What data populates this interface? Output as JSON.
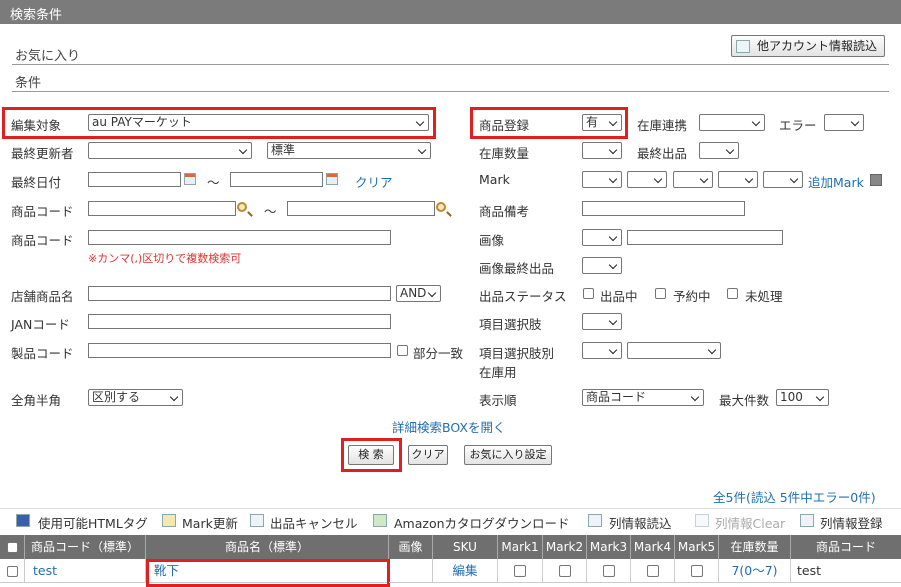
{
  "header": {
    "title": "検索条件"
  },
  "favorites": {
    "title": "お気に入り",
    "other_account_button": "他アカウント情報読込"
  },
  "conditions": {
    "title": "条件"
  },
  "left": {
    "edit_target_label": "編集対象",
    "edit_target_value": "au PAYマーケット",
    "last_updater_label": "最終更新者",
    "last_updater_mode": "標準",
    "last_date_label": "最終日付",
    "tilde": "～",
    "clear_link": "クリア",
    "product_code_label": "商品コード",
    "product_code2_label": "商品コード",
    "comma_note": "※カンマ(,)区切りで複数検索可",
    "shop_product_label": "店舗商品名",
    "shop_product_op": "AND",
    "jan_label": "JANコード",
    "maker_code_label": "製品コード",
    "partial_match_label": "部分一致",
    "width_label": "全角半角",
    "width_value": "区別する"
  },
  "right": {
    "registration_label": "商品登録",
    "registration_value": "有",
    "stock_link_label": "在庫連携",
    "error_label": "エラー",
    "stock_qty_label": "在庫数量",
    "last_listing_label": "最終出品",
    "mark_label": "Mark",
    "add_mark_link": "追加Mark",
    "remarks_label": "商品備考",
    "image_label": "画像",
    "image_last_label": "画像最終出品",
    "listing_status_label": "出品ステータス",
    "status_listing": "出品中",
    "status_reserved": "予約中",
    "status_unprocessed": "未処理",
    "variant_label": "項目選択肢",
    "variant_stock_label1": "項目選択肢別",
    "variant_stock_label2": "在庫用",
    "sort_label": "表示順",
    "sort_value": "商品コード",
    "max_label": "最大件数",
    "max_value": "100"
  },
  "advanced_link": "詳細検索BOXを開く",
  "buttons": {
    "search": "検 索",
    "clear": "クリア",
    "fav_settings": "お気に入り設定"
  },
  "summary": {
    "text": "全5件(読込 5件中エラー0件)"
  },
  "toolbar": {
    "html_tag": "使用可能HTMLタグ",
    "mark_update": "Mark更新",
    "cancel_listing": "出品キャンセル",
    "amazon_download": "Amazonカタログダウンロード",
    "column_load": "列情報読込",
    "column_clear": "列情報Clear",
    "column_register": "列情報登録"
  },
  "table": {
    "headers": [
      "商品コード（標準）",
      "商品名（標準）",
      "画像",
      "SKU",
      "Mark1",
      "Mark2",
      "Mark3",
      "Mark4",
      "Mark5",
      "在庫数量",
      "商品コード"
    ],
    "row": {
      "code": "test",
      "name": "靴下",
      "sku": "編集",
      "stock": "7(0〜7)",
      "code2": "test"
    }
  },
  "colors": {
    "highlight": "#e02020",
    "link": "#1f6fb0",
    "header_bg": "#7b7b7b"
  }
}
